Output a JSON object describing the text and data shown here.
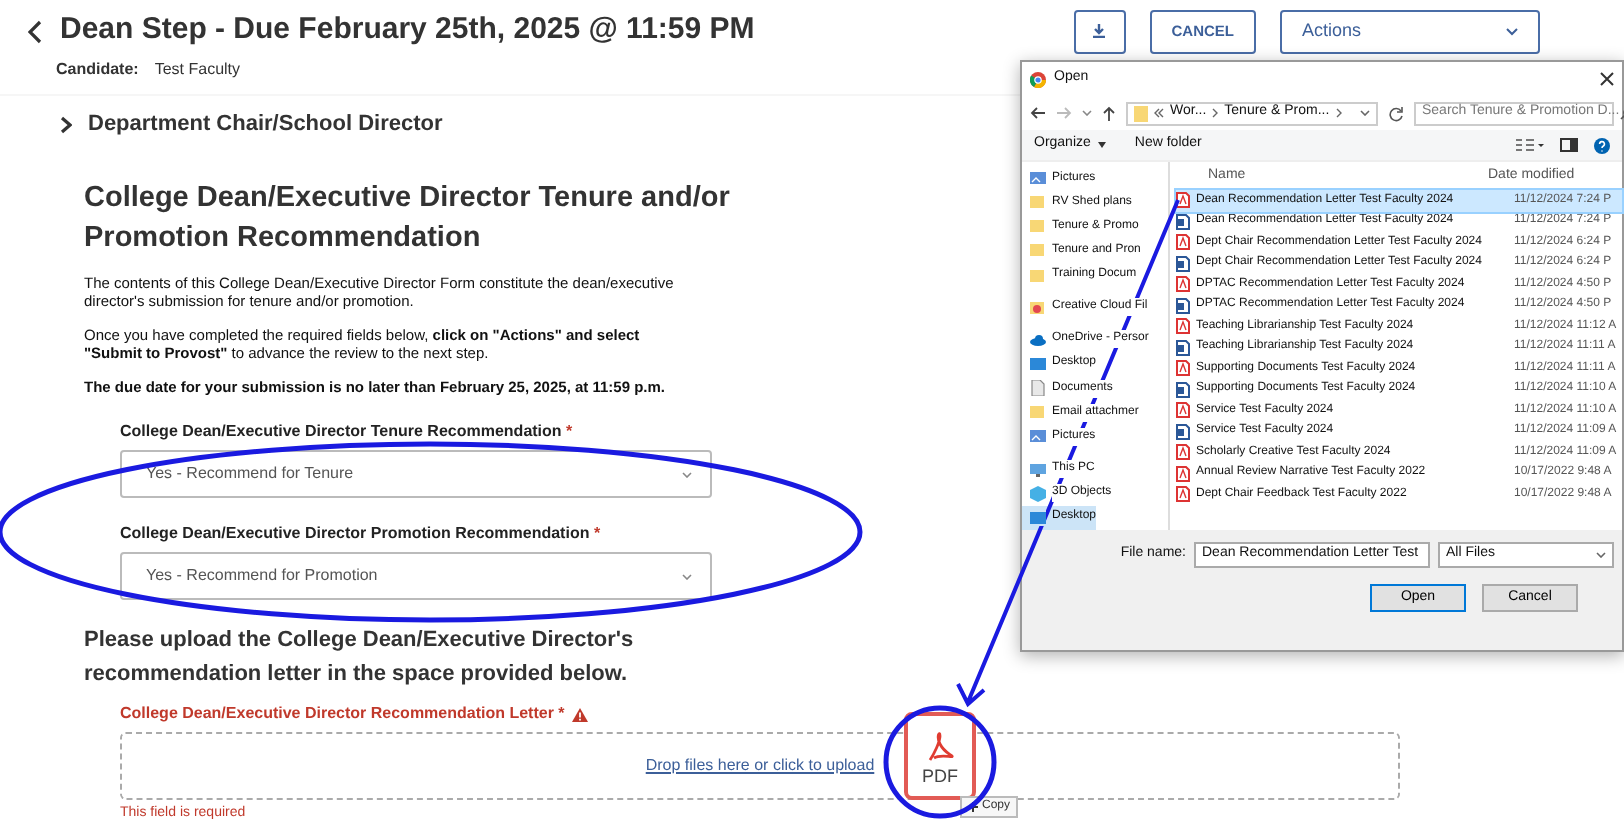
{
  "header": {
    "title": "Dean Step - Due February 25th, 2025 @ 11:59 PM",
    "candidate_label": "Candidate:",
    "candidate": "Test Faculty",
    "buttons": [
      {
        "kind": "download"
      },
      {
        "kind": "text",
        "label": "CANCEL"
      },
      {
        "kind": "dropdown",
        "label": "Actions"
      }
    ]
  },
  "section": {
    "title": "Department Chair/School Director",
    "expanded": false
  },
  "form": {
    "title": "College Dean/Executive Director Tenure and/or Promotion Recommendation",
    "paragraphs": [
      {
        "text": "The contents of this College Dean/Executive Director Form constitute the dean/executive director's submission for tenure and/or promotion.",
        "bold": false
      },
      {
        "text": "Once you have completed the required fields below, **click on \"Actions\" and select \"Submit to Provost\"** to advance the review to the next step.",
        "bold": false
      },
      {
        "text": "The due date for your submission is no later than February 25, 2025, at 11:59 p.m.",
        "bold": true
      }
    ],
    "selects": [
      {
        "label": "College Dean/Executive Director Tenure Recommendation",
        "required_mark": "*",
        "value": "Yes - Recommend for Tenure"
      },
      {
        "label": "College Dean/Executive Director Promotion Recommendation",
        "required_mark": "*",
        "value": "Yes - Recommend for Promotion"
      }
    ],
    "upload_heading": "Please upload the College Dean/Executive Director's recommendation letter in the space provided below.",
    "upload": {
      "label": "College Dean/Executive Director Recommendation Letter",
      "required_mark": "*",
      "warning": true,
      "link": "Drop files here or click to upload",
      "error": "This field is required"
    }
  },
  "dialog": {
    "title": "Open",
    "path": [
      "Wor...",
      "Tenure & Prom..."
    ],
    "search_placeholder": "Search Tenure & Promotion D...",
    "toolbar": [
      "Organize",
      "New folder"
    ],
    "columns": [
      "Name",
      "Date modified"
    ],
    "nav_items": [
      {
        "kind": "pictures",
        "label": "Pictures",
        "selected": false
      },
      {
        "kind": "folder",
        "label": "RV Shed plans",
        "selected": false
      },
      {
        "kind": "folder",
        "label": "Tenure & Promo",
        "selected": false
      },
      {
        "kind": "folder",
        "label": "Tenure and Pron",
        "selected": false
      },
      {
        "kind": "folder",
        "label": "Training Docum",
        "selected": false
      },
      {
        "kind": "creative",
        "label": "Creative Cloud Fil",
        "selected": false
      },
      {
        "kind": "cloud",
        "label": "OneDrive - Persor",
        "selected": false
      },
      {
        "kind": "desktop",
        "label": "Desktop",
        "selected": false
      },
      {
        "kind": "docs",
        "label": "Documents",
        "selected": false
      },
      {
        "kind": "folder",
        "label": "Email attachmer",
        "selected": false
      },
      {
        "kind": "pictures",
        "label": "Pictures",
        "selected": false
      },
      {
        "kind": "pc",
        "label": "This PC",
        "selected": false
      },
      {
        "kind": "objects",
        "label": "3D Objects",
        "selected": false
      },
      {
        "kind": "desktop",
        "label": "Desktop",
        "selected": true
      }
    ],
    "files": [
      {
        "kind": "pdf",
        "name": "Dean Recommendation Letter Test Faculty 2024",
        "date": "11/12/2024 7:24 P",
        "selected": true
      },
      {
        "kind": "word",
        "name": "Dean Recommendation Letter Test Faculty 2024",
        "date": "11/12/2024 7:24 P",
        "selected": false
      },
      {
        "kind": "pdf",
        "name": "Dept Chair Recommendation Letter Test Faculty 2024",
        "date": "11/12/2024 6:24 P",
        "selected": false
      },
      {
        "kind": "word",
        "name": "Dept Chair Recommendation Letter Test Faculty 2024",
        "date": "11/12/2024 6:24 P",
        "selected": false
      },
      {
        "kind": "pdf",
        "name": "DPTAC Recommendation Letter Test Faculty 2024",
        "date": "11/12/2024 4:50 P",
        "selected": false
      },
      {
        "kind": "word",
        "name": "DPTAC Recommendation Letter Test Faculty 2024",
        "date": "11/12/2024 4:50 P",
        "selected": false
      },
      {
        "kind": "pdf",
        "name": "Teaching Librarianship Test Faculty 2024",
        "date": "11/12/2024 11:12 A",
        "selected": false
      },
      {
        "kind": "word",
        "name": "Teaching Librarianship Test Faculty 2024",
        "date": "11/12/2024 11:11 A",
        "selected": false
      },
      {
        "kind": "pdf",
        "name": "Supporting Documents Test Faculty 2024",
        "date": "11/12/2024 11:11 A",
        "selected": false
      },
      {
        "kind": "word",
        "name": "Supporting Documents Test Faculty 2024",
        "date": "11/12/2024 11:10 A",
        "selected": false
      },
      {
        "kind": "pdf",
        "name": "Service Test Faculty 2024",
        "date": "11/12/2024 11:10 A",
        "selected": false
      },
      {
        "kind": "word",
        "name": "Service Test Faculty 2024",
        "date": "11/12/2024 11:09 A",
        "selected": false
      },
      {
        "kind": "pdf",
        "name": "Scholarly Creative Test Faculty 2024",
        "date": "11/12/2024 11:09 A",
        "selected": false
      },
      {
        "kind": "pdf",
        "name": "Annual Review Narrative Test Faculty 2022",
        "date": "10/17/2022 9:48 A",
        "selected": false
      },
      {
        "kind": "pdf",
        "name": "Dept Chair Feedback Test Faculty 2022",
        "date": "10/17/2022 9:48 A",
        "selected": false
      }
    ],
    "file_name_label": "File name:",
    "file_name": "Dean Recommendation Letter Test",
    "filter": "All Files",
    "buttons": [
      "Open",
      "Cancel"
    ]
  },
  "drag": {
    "label": "PDF",
    "tooltip": "Copy"
  }
}
